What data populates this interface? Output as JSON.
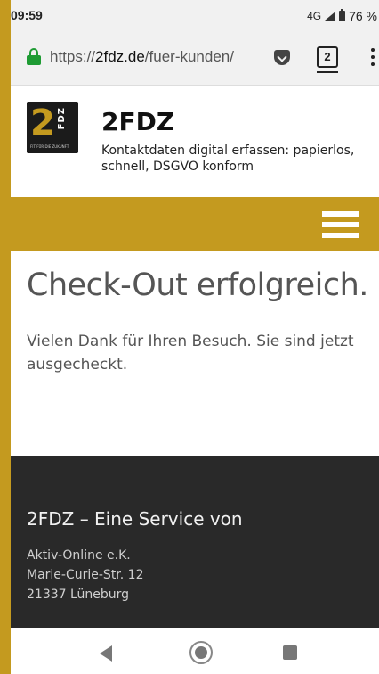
{
  "status": {
    "time": "09:59",
    "network": "4G",
    "battery": "76 %"
  },
  "browser": {
    "url_prefix": "https://",
    "url_host": "2fdz.de",
    "url_path": "/fuer-kunden/",
    "tab_count": "2"
  },
  "site": {
    "logo_numeral": "2",
    "logo_letters": "FDZ",
    "logo_tagline": "FIT FÜR DIE ZUKUNFT",
    "title": "2FDZ",
    "description": "Kontaktdaten digital erfassen: papierlos, schnell, DSGVO konform"
  },
  "main": {
    "heading": "Check-Out erfolgreich.",
    "text": "Vielen Dank für Ihren Besuch. Sie sind jetzt ausgecheckt."
  },
  "footer": {
    "heading": "2FDZ – Eine Service von",
    "address_line1": "Aktiv-Online e.K.",
    "address_line2": "Marie-Curie-Str. 12",
    "address_line3": "21337 Lüneburg"
  },
  "colors": {
    "accent": "#c49a1f",
    "footer_bg": "#292929",
    "secure_green": "#1e9b33"
  }
}
